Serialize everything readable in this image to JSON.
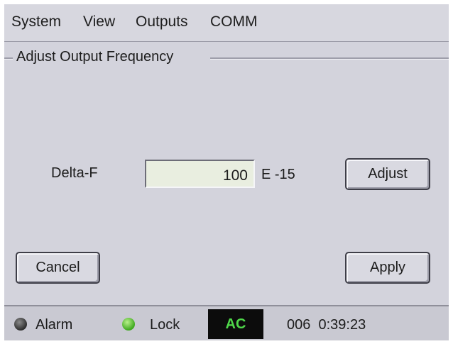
{
  "menu": {
    "system": "System",
    "view": "View",
    "outputs": "Outputs",
    "comm": "COMM"
  },
  "panel": {
    "title": "Adjust Output Frequency"
  },
  "delta": {
    "label": "Delta-F",
    "value": "100",
    "unit": "E -15"
  },
  "buttons": {
    "adjust": "Adjust",
    "cancel": "Cancel",
    "apply": "Apply"
  },
  "status": {
    "alarm_label": "Alarm",
    "alarm_led_color": "#3a3a3a",
    "lock_label": "Lock",
    "lock_led_color": "#4cc22a",
    "power_mode": "AC",
    "power_mode_color": "#4fd84a",
    "time_readout": "006  0:39:23"
  }
}
